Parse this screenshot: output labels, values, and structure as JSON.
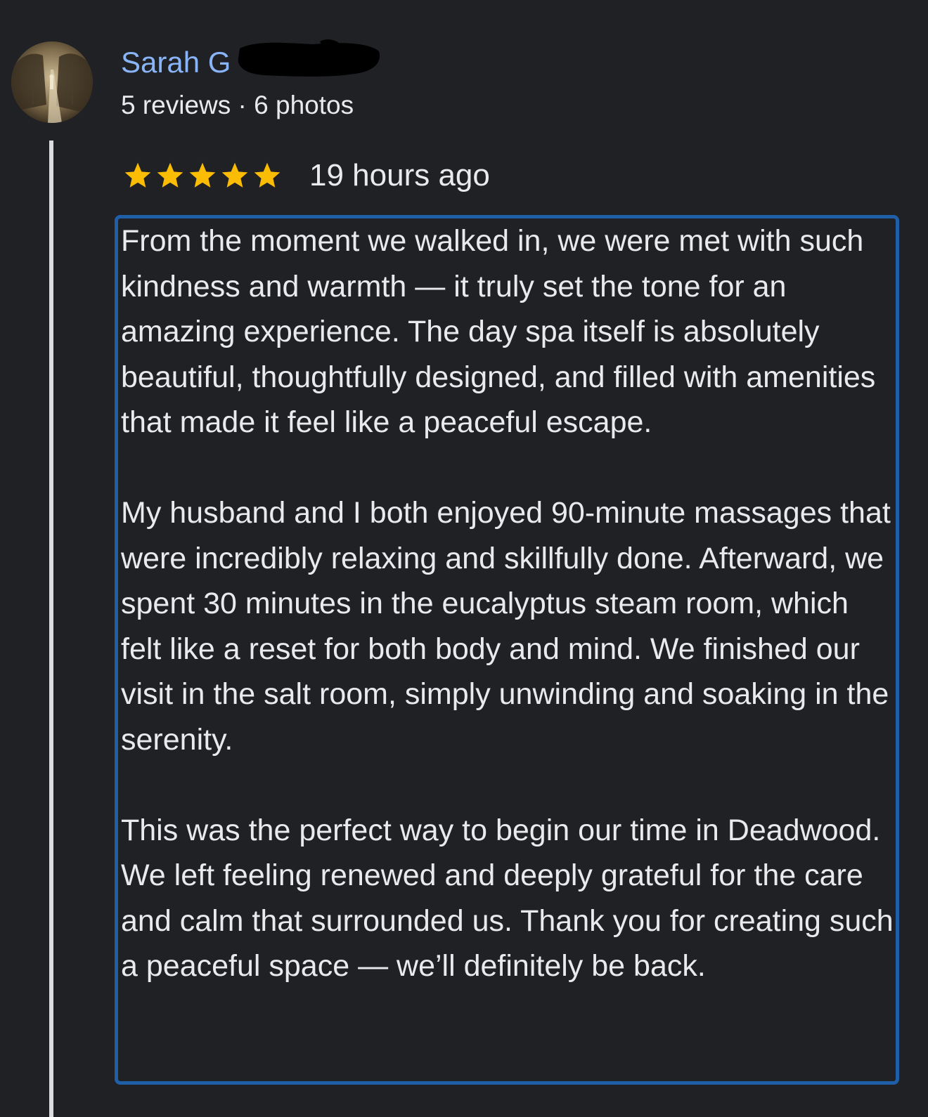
{
  "reviewer": {
    "name": "Sarah G",
    "stats": "5 reviews · 6 photos"
  },
  "review": {
    "rating_stars": 5,
    "star_color": "#fbbc04",
    "time_ago": "19 hours ago",
    "paragraphs": [
      "From the moment we walked in, we were met with such kindness and warmth — it truly set the tone for an amazing experience. The day spa itself is absolutely beautiful, thoughtfully designed, and filled with amenities that made it feel like a peaceful escape.",
      "My husband and I both enjoyed 90-minute massages that were incredibly relaxing and skillfully done. Afterward, we spent 30 minutes in the eucalyptus steam room, which felt like a reset for both body and mind. We finished our visit in the salt room, simply unwinding and soaking in the serenity.",
      "This was the perfect way to begin our time in Deadwood. We left feeling renewed and deeply grateful for the care and calm that surrounded us. Thank you for creating such a peaceful space — we’ll definitely be back."
    ]
  },
  "colors": {
    "background": "#202124",
    "name_link": "#8ab4f8",
    "highlight_border": "#1f5fa8"
  }
}
